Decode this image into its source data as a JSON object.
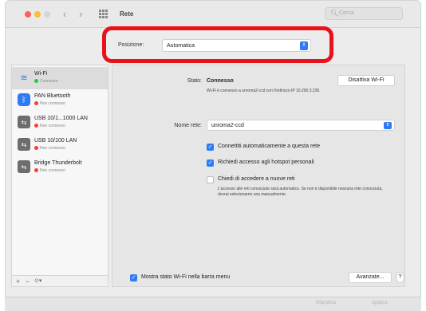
{
  "window": {
    "title": "Rete"
  },
  "toolbar": {
    "search_placeholder": "Cerca",
    "back": "‹",
    "forward": "›"
  },
  "location": {
    "label": "Posizione:",
    "value": "Automatica"
  },
  "sidebar": {
    "items": [
      {
        "name": "Wi-Fi",
        "status": "Connesso",
        "status_color": "green",
        "icon": "wifi-icon",
        "active": true
      },
      {
        "name": "PAN Bluetooth",
        "status": "Non connesso",
        "status_color": "red",
        "icon": "bluetooth-icon",
        "active": false
      },
      {
        "name": "USB 10/1...1000 LAN",
        "status": "Non connesso",
        "status_color": "red",
        "icon": "ethernet-icon",
        "active": false
      },
      {
        "name": "USB 10/100 LAN",
        "status": "Non connesso",
        "status_color": "red",
        "icon": "ethernet-icon",
        "active": false
      },
      {
        "name": "Bridge Thunderbolt",
        "status": "Non connesso",
        "status_color": "red",
        "icon": "ethernet-icon",
        "active": false
      }
    ],
    "footer": {
      "add": "+",
      "remove": "−",
      "actions": "⊙▾"
    }
  },
  "detail": {
    "status_label": "Stato:",
    "status_value": "Connesso",
    "disable_button": "Disattiva Wi-Fi",
    "status_note": "Wi-Fi è connesso a unroma2-ccd con l'indirizzo IP 10.200.3.236.",
    "network_label": "Nome rete:",
    "network_value": "unroma2-ccd",
    "auto_join": "Connettiti automaticamente a questa rete",
    "ask_hotspot": "Richiedi accesso agli hotspot personali",
    "ask_new": "Chiedi di accedere a nuove reti",
    "ask_new_note": "L'accesso alle reti conosciute sarà automatico. Se non è disponibile nessuna rete conosciuta, dovrai selezionarne una manualmente.",
    "show_status": "Mostra stato Wi-Fi nella barra menu",
    "advanced_button": "Avanzate...",
    "help_button": "?"
  },
  "footer_buttons": {
    "revert": "Ripristina",
    "apply": "Applica"
  },
  "colors": {
    "accent": "#2f7bf5",
    "highlight": "#e8131a",
    "connected": "#28c840",
    "disconnected": "#ff3b30"
  }
}
